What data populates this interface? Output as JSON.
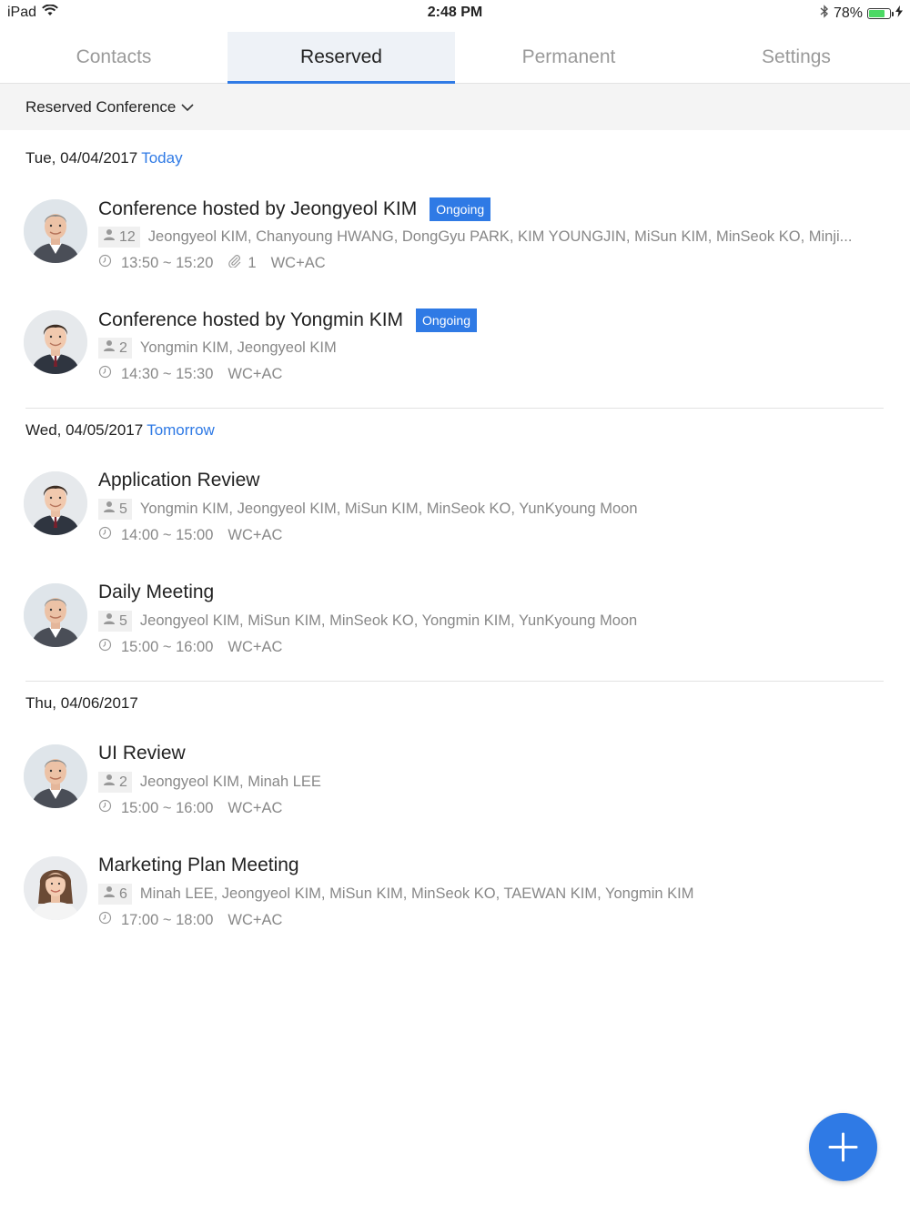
{
  "status": {
    "device": "iPad",
    "time": "2:48 PM",
    "battery": "78%",
    "battery_level": 0.78
  },
  "tabs": [
    {
      "label": "Contacts"
    },
    {
      "label": "Reserved"
    },
    {
      "label": "Permanent"
    },
    {
      "label": "Settings"
    }
  ],
  "filter": {
    "label": "Reserved Conference"
  },
  "days": [
    {
      "date": "Tue, 04/04/2017",
      "relative": "Today",
      "items": [
        {
          "title": "Conference hosted by Jeongyeol KIM",
          "badge": "Ongoing",
          "count": "12",
          "members": "Jeongyeol KIM, Chanyoung HWANG, DongGyu PARK, KIM YOUNGJIN, MiSun KIM, MinSeok KO, Minji...",
          "time": "13:50 ~ 15:20",
          "attachments": "1",
          "room": "WC+AC",
          "avatar": "man-avatar-1"
        },
        {
          "title": "Conference hosted by Yongmin KIM",
          "badge": "Ongoing",
          "count": "2",
          "members": "Yongmin KIM, Jeongyeol KIM",
          "time": "14:30 ~ 15:30",
          "room": "WC+AC",
          "avatar": "man-avatar-2"
        }
      ]
    },
    {
      "date": "Wed, 04/05/2017",
      "relative": "Tomorrow",
      "items": [
        {
          "title": "Application Review",
          "count": "5",
          "members": "Yongmin KIM, Jeongyeol KIM, MiSun KIM, MinSeok KO, YunKyoung Moon",
          "time": "14:00 ~ 15:00",
          "room": "WC+AC",
          "avatar": "man-avatar-2"
        },
        {
          "title": "Daily Meeting",
          "count": "5",
          "members": "Jeongyeol KIM, MiSun KIM, MinSeok KO, Yongmin KIM, YunKyoung Moon",
          "time": "15:00 ~ 16:00",
          "room": "WC+AC",
          "avatar": "man-avatar-1"
        }
      ]
    },
    {
      "date": "Thu, 04/06/2017",
      "items": [
        {
          "title": "UI Review",
          "count": "2",
          "members": "Jeongyeol KIM, Minah LEE",
          "time": "15:00 ~ 16:00",
          "room": "WC+AC",
          "avatar": "man-avatar-1"
        },
        {
          "title": "Marketing Plan Meeting",
          "count": "6",
          "members": "Minah LEE, Jeongyeol KIM, MiSun KIM, MinSeok KO, TAEWAN KIM, Yongmin KIM",
          "time": "17:00 ~ 18:00",
          "room": "WC+AC",
          "avatar": "woman-avatar"
        }
      ]
    }
  ],
  "colors": {
    "accent": "#2f7ae5",
    "battery": "#4cd964",
    "muted": "#888888"
  }
}
